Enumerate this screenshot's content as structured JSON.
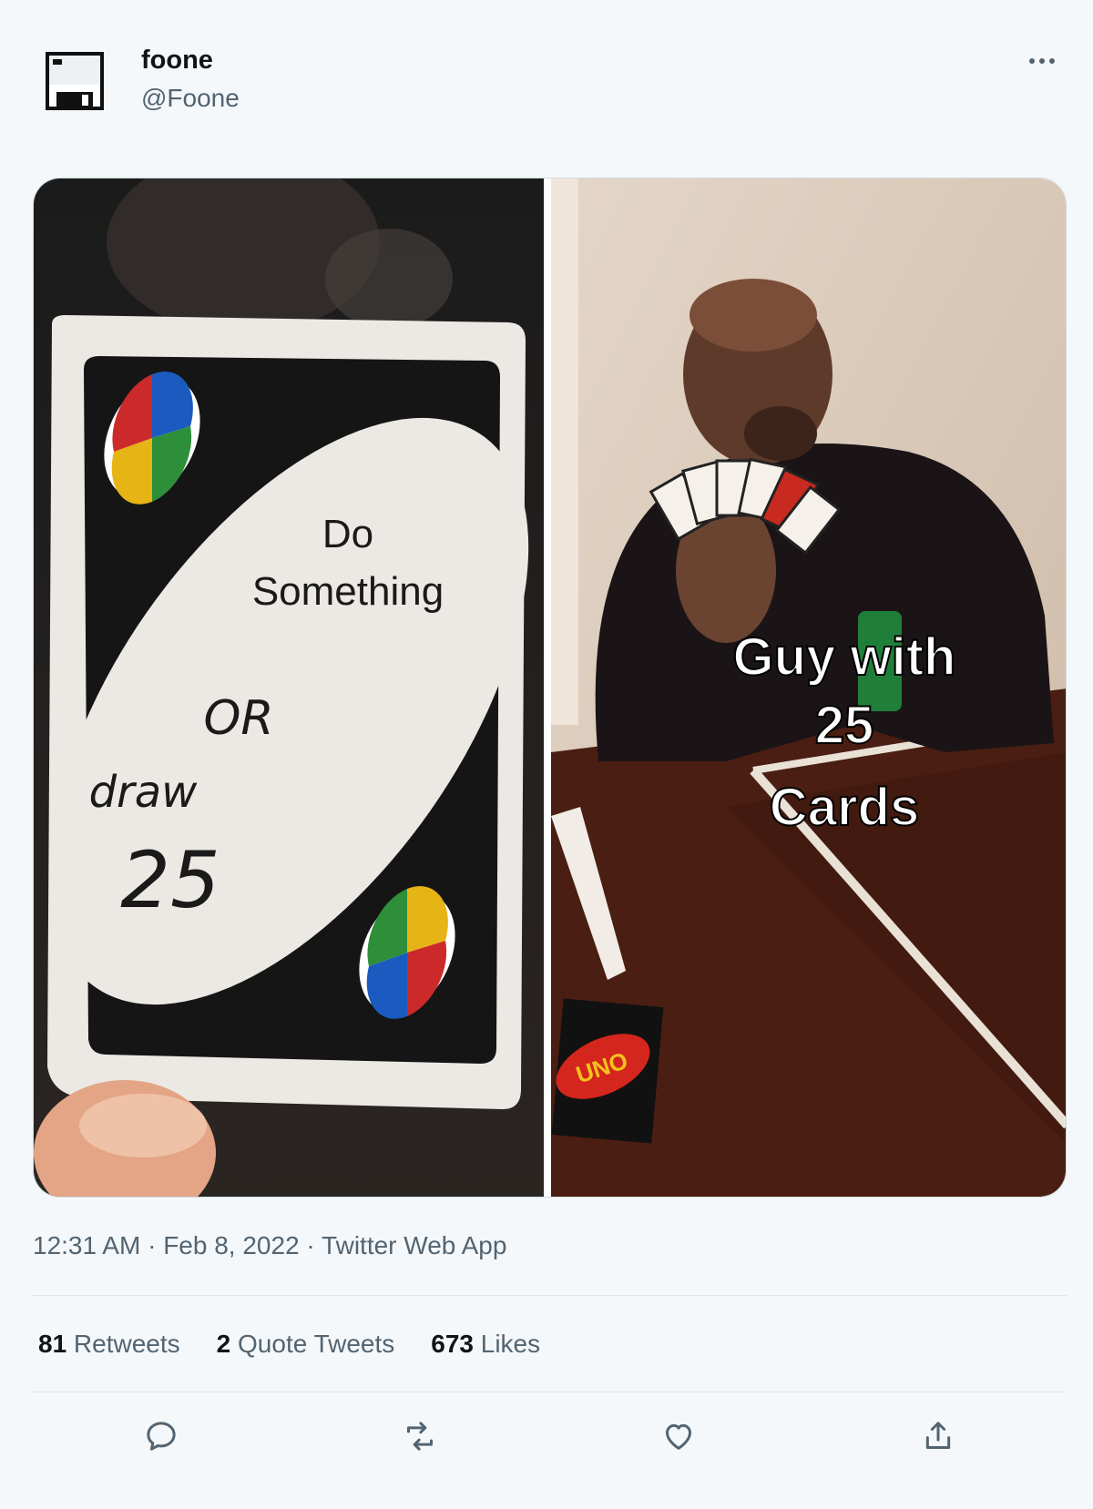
{
  "author": {
    "name": "foone",
    "handle": "@Foone",
    "avatar_icon": "floppy-disk-icon"
  },
  "media": {
    "left_panel": {
      "lines": [
        "Do",
        "Something"
      ],
      "handwritten": [
        "OR",
        "draw",
        "25"
      ]
    },
    "right_panel": {
      "lines": [
        "Guy with",
        "25",
        "Cards"
      ]
    }
  },
  "meta": {
    "time": "12:31 AM",
    "date": "Feb 8, 2022",
    "source": "Twitter Web App",
    "separator": " · "
  },
  "stats": {
    "retweets_count": "81",
    "retweets_label": " Retweets",
    "quotes_count": "2",
    "quotes_label": " Quote Tweets",
    "likes_count": "673",
    "likes_label": " Likes"
  },
  "actions": {
    "reply_icon": "reply-icon",
    "retweet_icon": "retweet-icon",
    "like_icon": "heart-icon",
    "share_icon": "share-icon"
  },
  "colors": {
    "text_primary": "#0f1419",
    "text_secondary": "#536471",
    "background": "#f5f8fa",
    "divider": "#e1e6ea"
  }
}
